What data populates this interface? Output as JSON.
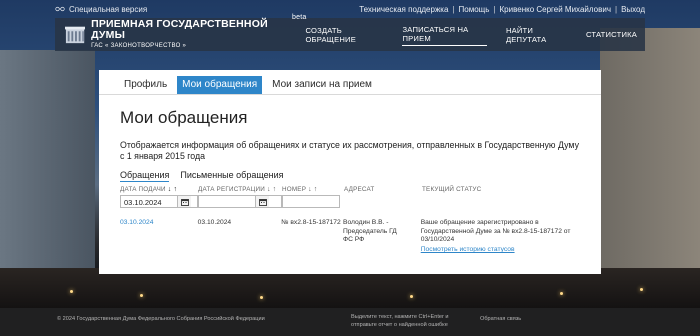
{
  "topbar": {
    "special_version": "Специальная версия",
    "support": "Техническая поддержка",
    "help": "Помощь",
    "user": "Кривенко Сергей Михайлович",
    "logout": "Выход",
    "separator": "|"
  },
  "header": {
    "title": "ПРИЕМНАЯ ГОСУДАРСТВЕННОЙ ДУМЫ",
    "beta": "beta",
    "subtitle": "ГАС « ЗАКОНОТВОРЧЕСТВО »",
    "nav": [
      {
        "label": "СОЗДАТЬ ОБРАЩЕНИЕ"
      },
      {
        "label": "ЗАПИСАТЬСЯ НА ПРИЕМ"
      },
      {
        "label": "НАЙТИ ДЕПУТАТА"
      },
      {
        "label": "СТАТИСТИКА"
      }
    ]
  },
  "tabs": [
    {
      "label": "Профиль"
    },
    {
      "label": "Мои обращения"
    },
    {
      "label": "Мои записи на прием"
    }
  ],
  "page": {
    "title": "Мои обращения",
    "description": "Отображается информация об обращениях и статусе их рассмотрения, отправленных в Государственную Думу с 1 января 2015 года"
  },
  "subtabs": [
    {
      "label": "Обращения"
    },
    {
      "label": "Письменные обращения"
    }
  ],
  "table": {
    "headers": {
      "submit_date": "ДАТА ПОДАЧИ",
      "reg_date": "ДАТА РЕГИСТРАЦИИ",
      "number": "НОМЕР",
      "addressee": "АДРЕСАТ",
      "status": "ТЕКУЩИЙ СТАТУС"
    },
    "filters": {
      "submit_date": "03.10.2024",
      "reg_date": "",
      "number": ""
    },
    "rows": [
      {
        "submit_date": "03.10.2024",
        "reg_date": "03.10.2024",
        "number": "№ вх2.8-15-187172",
        "addressee": "Володин В.В. - Председатель ГД ФС РФ",
        "status": "Ваше обращение зарегистрировано в Государственной Думе за № вх2.8-15-187172 от 03/10/2024",
        "status_link": "Посмотреть историю статусов"
      }
    ]
  },
  "footer": {
    "copyright": "© 2024 Государственная Дума Федерального Собрания Российской Федерации",
    "hint_line1": "Выделите текст, нажмите Ctrl+Enter и",
    "hint_line2": "отправьте отчет о найденной ошибке",
    "feedback": "Обратная связь"
  },
  "colors": {
    "accent": "#2e86c9",
    "header_bg": "#283446",
    "footer_bg": "#202021"
  }
}
